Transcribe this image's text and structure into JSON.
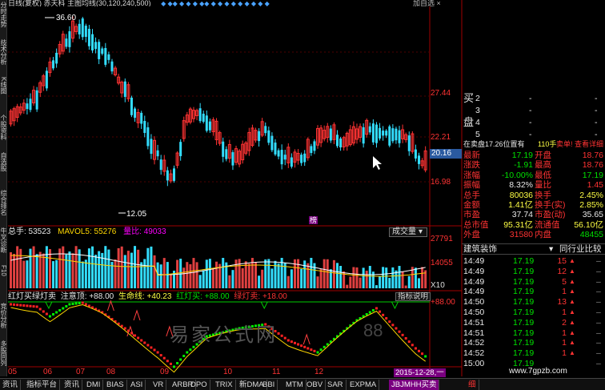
{
  "header": {
    "title_text": "日线(复权)  赤天科  主图均线(30,120,240,500)",
    "right_text": "加自选  ×"
  },
  "left_tabs": [
    "分时走势",
    "技术分析",
    "K线图",
    "个股资料",
    "自选股",
    "综合排名",
    "牛叉诊断",
    "F10",
    "竞价分析",
    "多股同列"
  ],
  "main_chart": {
    "high_label": "36.60",
    "low_label": "12.05",
    "axis_labels": [
      "27.44",
      "22.21",
      "16.98"
    ],
    "current_price": "20.16",
    "marker_label": "榜"
  },
  "volume_panel": {
    "total_label": "总手: 53523",
    "mavol_label": "MAVOL5: 55276",
    "ratio_label": "量比: 49033",
    "dropdown_label": "成交量",
    "axis_labels": [
      "27791",
      "14055"
    ],
    "multiplier_label": "X10"
  },
  "indicator_panel": {
    "title": "红灯买绿灯卖",
    "items": [
      "注意顶: +88.00",
      "生命线: +40.23",
      "红灯买: +88.00",
      "绿灯卖: +18.00"
    ],
    "help_label": "指标说明",
    "axis_label": "+88.00"
  },
  "date_axis": [
    "05",
    "06",
    "07",
    "08",
    "09",
    "10",
    "11",
    "12"
  ],
  "date_badge": "2015-12-28,一",
  "watermark": "易家公式网",
  "watermark_url": "www.7gpzb.com",
  "quote_panel": {
    "orderbook": [
      {
        "side": "买",
        "level": "2",
        "price": "-",
        "vol": "-"
      },
      {
        "side": "",
        "level": "3",
        "price": "-",
        "vol": "-"
      },
      {
        "side": "盘",
        "level": "4",
        "price": "-",
        "vol": "-"
      },
      {
        "side": "",
        "level": "5",
        "price": "-",
        "vol": "-"
      }
    ],
    "status_line": {
      "left": "在卖盘17.26位置有",
      "vol": "110手",
      "right": "卖单! 查看详细"
    },
    "fields": [
      {
        "l1": "最新",
        "v1": "17.19",
        "c1": "green",
        "l2": "开盘",
        "v2": "18.76",
        "c2": "red"
      },
      {
        "l1": "涨跌",
        "v1": "-1.91",
        "c1": "green",
        "l2": "最高",
        "v2": "18.76",
        "c2": "red"
      },
      {
        "l1": "涨幅",
        "v1": "-10.00%",
        "c1": "green",
        "l2": "最低",
        "v2": "17.19",
        "c2": "green"
      },
      {
        "l1": "振幅",
        "v1": "8.32%",
        "c1": "white",
        "l2": "量比",
        "v2": "1.45",
        "c2": "red"
      },
      {
        "l1": "总手",
        "v1": "80036",
        "c1": "yellow",
        "l2": "换手",
        "v2": "2.45%",
        "c2": "yellow"
      },
      {
        "l1": "金额",
        "v1": "1.41亿",
        "c1": "yellow",
        "l2": "换手(实)",
        "v2": "2.85%",
        "c2": "yellow"
      },
      {
        "l1": "市盈",
        "v1": "37.74",
        "c1": "white",
        "l2": "市盈(动)",
        "v2": "35.65",
        "c2": "white"
      },
      {
        "l1": "总市值",
        "v1": "95.31亿",
        "c1": "yellow",
        "l2": "流通值",
        "v2": "56.10亿",
        "c2": "yellow"
      },
      {
        "l1": "外盘",
        "v1": "31580",
        "c1": "red",
        "l2": "内盘",
        "v2": "48455",
        "c2": "green"
      }
    ],
    "sector_tab": "建筑装饰",
    "compare_tab": "同行业比较",
    "ticks": [
      {
        "t": "14:49",
        "p": "17.19",
        "v": "15"
      },
      {
        "t": "14:49",
        "p": "17.19",
        "v": "12"
      },
      {
        "t": "14:49",
        "p": "17.19",
        "v": "5"
      },
      {
        "t": "14:49",
        "p": "17.19",
        "v": "1"
      },
      {
        "t": "14:50",
        "p": "17.19",
        "v": "13"
      },
      {
        "t": "14:50",
        "p": "17.19",
        "v": "1"
      },
      {
        "t": "14:51",
        "p": "17.19",
        "v": "2"
      },
      {
        "t": "14:51",
        "p": "17.19",
        "v": "1"
      },
      {
        "t": "14:52",
        "p": "17.19",
        "v": "1"
      },
      {
        "t": "14:52",
        "p": "17.19",
        "v": "1"
      },
      {
        "t": "15:00",
        "p": "17.19",
        "v": ""
      }
    ]
  },
  "bottom_tabs": [
    "资讯",
    "指标平台",
    "资讯",
    "DMI",
    "BIAS",
    "ASI",
    "VR",
    "ARBR",
    "DPO",
    "TRIX",
    "新DMA",
    "BBI",
    "MTM",
    "OBV",
    "SAR",
    "EXPMA",
    "JBJMHH买卖"
  ],
  "bottom_extra": "细",
  "colors": {
    "up": "#ff3333",
    "down": "#33ddff",
    "ma": "#ffffff",
    "ma2": "#ffd700",
    "buy": "#00ee00",
    "sell": "#ff2222"
  }
}
